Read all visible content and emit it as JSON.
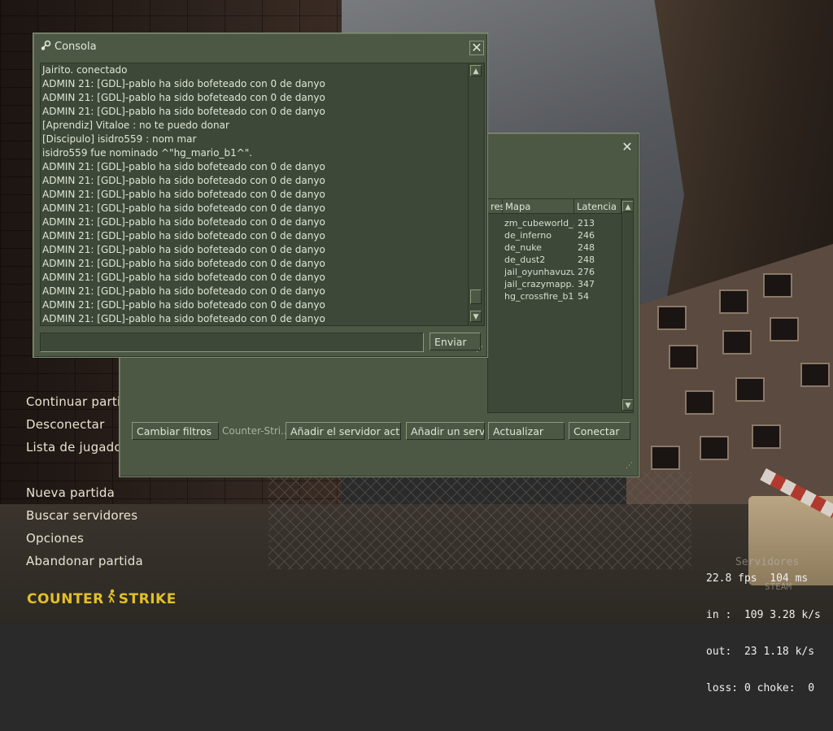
{
  "main_menu": {
    "items": [
      {
        "label": "Continuar partida"
      },
      {
        "label": "Desconectar"
      },
      {
        "label": "Lista de jugadores"
      },
      {
        "label": "Nueva partida"
      },
      {
        "label": "Buscar servidores"
      },
      {
        "label": "Opciones"
      },
      {
        "label": "Abandonar partida"
      }
    ],
    "logo_text_left": "COUNTER",
    "logo_text_right": "STRIKE",
    "logo_icon": "counter-terrorist-figure-icon",
    "logo_color": "#e2c026"
  },
  "net_stats": {
    "fps_line": "22.8 fps  104 ms",
    "in_line": "in :  109 3.28 k/s",
    "out_line": "out:  23 1.18 k/s",
    "loss_line": "loss: 0 choke:  0",
    "overlay_text": "Servidores",
    "overlay_brand": "STEAM"
  },
  "server_browser": {
    "columns": {
      "partial": "res",
      "map": "Mapa",
      "latency": "Latencia"
    },
    "rows": [
      {
        "map": "zm_cubeworld_...",
        "latency": "213"
      },
      {
        "map": "de_inferno",
        "latency": "246"
      },
      {
        "map": "de_nuke",
        "latency": "248"
      },
      {
        "map": "de_dust2",
        "latency": "248"
      },
      {
        "map": "jail_oyunhavuzu",
        "latency": "276"
      },
      {
        "map": "jail_crazymapp...",
        "latency": "347"
      },
      {
        "map": "hg_crossfire_b1",
        "latency": "54"
      }
    ],
    "buttons": {
      "change_filters": "Cambiar filtros",
      "filter_label": "Counter-Stri...",
      "add_current": "Añadir el servidor actual",
      "add_server": "Añadir un servi...",
      "refresh": "Actualizar",
      "connect": "Conectar"
    },
    "close_icon": "close-icon"
  },
  "console": {
    "title": "Consola",
    "title_icon": "steam-icon",
    "lines": [
      "Jairito. conectado",
      "ADMIN  21: [GDL]-pablo ha sido bofeteado con 0 de danyo",
      "ADMIN  21: [GDL]-pablo ha sido bofeteado con 0 de danyo",
      "ADMIN  21: [GDL]-pablo ha sido bofeteado con 0 de danyo",
      "[Aprendiz] Vitaloe : no te puedo donar",
      "[Discipulo] isidro559 : nom mar",
      "isidro559 fue nominado ^\"hg_mario_b1^\".",
      "ADMIN  21: [GDL]-pablo ha sido bofeteado con 0 de danyo",
      "ADMIN  21: [GDL]-pablo ha sido bofeteado con 0 de danyo",
      "ADMIN  21: [GDL]-pablo ha sido bofeteado con 0 de danyo",
      "ADMIN  21: [GDL]-pablo ha sido bofeteado con 0 de danyo",
      "ADMIN  21: [GDL]-pablo ha sido bofeteado con 0 de danyo",
      "ADMIN  21: [GDL]-pablo ha sido bofeteado con 0 de danyo",
      "ADMIN  21: [GDL]-pablo ha sido bofeteado con 0 de danyo",
      "ADMIN  21: [GDL]-pablo ha sido bofeteado con 0 de danyo",
      "ADMIN  21: [GDL]-pablo ha sido bofeteado con 0 de danyo",
      "ADMIN  21: [GDL]-pablo ha sido bofeteado con 0 de danyo",
      "ADMIN  21: [GDL]-pablo ha sido bofeteado con 0 de danyo",
      "ADMIN  21: [GDL]-pablo ha sido bofeteado con 0 de danyo"
    ],
    "input_value": "",
    "send_label": "Enviar",
    "close_icon": "close-icon"
  },
  "colors": {
    "panel_bg": "#4c5844",
    "panel_dark": "#3e4838",
    "panel_text": "#dfe6d5",
    "menu_text": "#e8e4cf"
  }
}
